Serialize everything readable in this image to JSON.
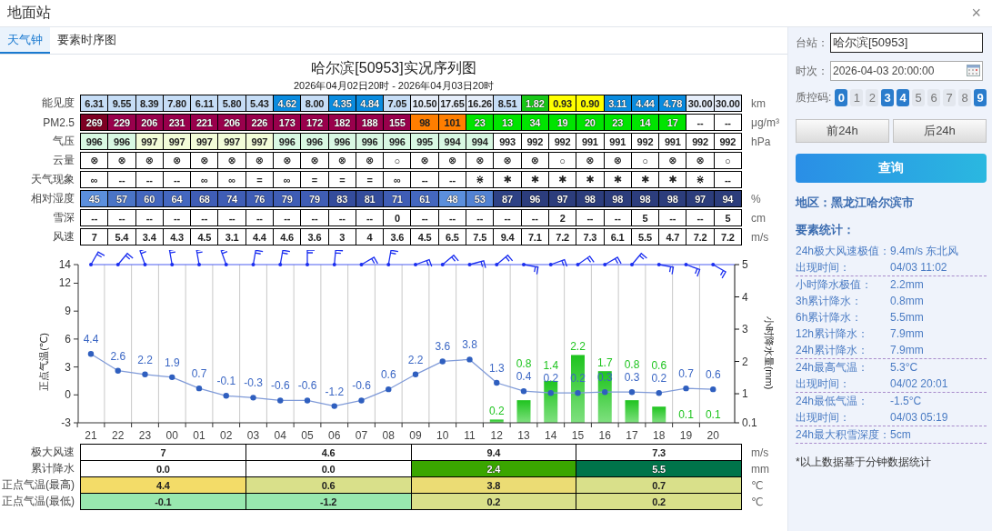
{
  "window": {
    "title": "地面站",
    "close": "×"
  },
  "tabs": [
    {
      "label": "天气钟",
      "selected": true
    },
    {
      "label": "要素时序图",
      "selected": false
    }
  ],
  "main": {
    "title": "哈尔滨[50953]实况序列图",
    "subtitle": "2026年04月02日20时 - 2026年04月03日20时",
    "table": {
      "rows": [
        {
          "label": "能见度",
          "unit": "km",
          "cells": [
            {
              "text": "6.31",
              "color": "#c6ddf6"
            },
            {
              "text": "9.55",
              "color": "#c6ddf6"
            },
            {
              "text": "8.39",
              "color": "#c6ddf6"
            },
            {
              "text": "7.80",
              "color": "#c6ddf6"
            },
            {
              "text": "6.11",
              "color": "#c6ddf6"
            },
            {
              "text": "5.80",
              "color": "#c6ddf6"
            },
            {
              "text": "5.43",
              "color": "#c6ddf6"
            },
            {
              "text": "4.62",
              "color": "#0a8ce0"
            },
            {
              "text": "8.00",
              "color": "#c6ddf6"
            },
            {
              "text": "4.35",
              "color": "#0a8ce0"
            },
            {
              "text": "4.84",
              "color": "#0a8ce0"
            },
            {
              "text": "7.05",
              "color": "#c6ddf6"
            },
            {
              "text": "10.50",
              "color": "#e6eefa"
            },
            {
              "text": "17.65",
              "color": "#e6eefa"
            },
            {
              "text": "16.26",
              "color": "#e6eefa"
            },
            {
              "text": "8.51",
              "color": "#c6ddf6"
            },
            {
              "text": "1.82",
              "color": "#18c818"
            },
            {
              "text": "0.93",
              "color": "#ffff00"
            },
            {
              "text": "0.90",
              "color": "#ffff00"
            },
            {
              "text": "3.11",
              "color": "#0a8ce0"
            },
            {
              "text": "4.44",
              "color": "#0a8ce0"
            },
            {
              "text": "4.78",
              "color": "#0a8ce0"
            },
            {
              "text": "30.00",
              "color": "#e6eefa"
            },
            {
              "text": "30.00",
              "color": "#e6eefa"
            }
          ]
        },
        {
          "label": "PM2.5",
          "unit": "μg/m³",
          "cells": [
            {
              "text": "269",
              "color": "#7e0023"
            },
            {
              "text": "229",
              "color": "#99004c"
            },
            {
              "text": "206",
              "color": "#99004c"
            },
            {
              "text": "231",
              "color": "#99004c"
            },
            {
              "text": "221",
              "color": "#99004c"
            },
            {
              "text": "206",
              "color": "#99004c"
            },
            {
              "text": "226",
              "color": "#99004c"
            },
            {
              "text": "173",
              "color": "#99004c"
            },
            {
              "text": "172",
              "color": "#99004c"
            },
            {
              "text": "182",
              "color": "#99004c"
            },
            {
              "text": "188",
              "color": "#99004c"
            },
            {
              "text": "155",
              "color": "#99004c"
            },
            {
              "text": "98",
              "color": "#ff7e00"
            },
            {
              "text": "101",
              "color": "#ff7e00"
            },
            {
              "text": "23",
              "color": "#00e400"
            },
            {
              "text": "13",
              "color": "#00e400"
            },
            {
              "text": "34",
              "color": "#00e400"
            },
            {
              "text": "19",
              "color": "#00e400"
            },
            {
              "text": "20",
              "color": "#00e400"
            },
            {
              "text": "23",
              "color": "#00e400"
            },
            {
              "text": "14",
              "color": "#00e400"
            },
            {
              "text": "17",
              "color": "#00e400"
            },
            {
              "text": "--",
              "color": "#ffffff"
            },
            {
              "text": "--",
              "color": "#ffffff"
            }
          ]
        },
        {
          "label": "气压",
          "unit": "hPa",
          "cells": [
            {
              "text": "996",
              "color": "#d8f8e2"
            },
            {
              "text": "996",
              "color": "#d8f8e2"
            },
            {
              "text": "997",
              "color": "#f2fcd8"
            },
            {
              "text": "997",
              "color": "#f2fcd8"
            },
            {
              "text": "997",
              "color": "#f2fcd8"
            },
            {
              "text": "997",
              "color": "#f2fcd8"
            },
            {
              "text": "997",
              "color": "#f2fcd8"
            },
            {
              "text": "996",
              "color": "#d8f8e2"
            },
            {
              "text": "996",
              "color": "#d8f8e2"
            },
            {
              "text": "996",
              "color": "#d8f8e2"
            },
            {
              "text": "996",
              "color": "#d8f8e2"
            },
            {
              "text": "996",
              "color": "#d8f8e2"
            },
            {
              "text": "995",
              "color": "#d8f8e2"
            },
            {
              "text": "994",
              "color": "#d8f8e2"
            },
            {
              "text": "994",
              "color": "#d8f8e2"
            },
            {
              "text": "993",
              "color": "#ffffff"
            },
            {
              "text": "992",
              "color": "#ffffff"
            },
            {
              "text": "992",
              "color": "#ffffff"
            },
            {
              "text": "991",
              "color": "#ffffff"
            },
            {
              "text": "991",
              "color": "#ffffff"
            },
            {
              "text": "992",
              "color": "#ffffff"
            },
            {
              "text": "991",
              "color": "#ffffff"
            },
            {
              "text": "992",
              "color": "#ffffff"
            },
            {
              "text": "992",
              "color": "#ffffff"
            }
          ]
        },
        {
          "label": "云量",
          "cells": [
            {
              "text": "⊗"
            },
            {
              "text": "⊗"
            },
            {
              "text": "⊗"
            },
            {
              "text": "⊗"
            },
            {
              "text": "⊗"
            },
            {
              "text": "⊗"
            },
            {
              "text": "⊗"
            },
            {
              "text": "⊗"
            },
            {
              "text": "⊗"
            },
            {
              "text": "⊗"
            },
            {
              "text": "⊗"
            },
            {
              "text": "○"
            },
            {
              "text": "⊗"
            },
            {
              "text": "⊗"
            },
            {
              "text": "⊗"
            },
            {
              "text": "⊗"
            },
            {
              "text": "⊗"
            },
            {
              "text": "○"
            },
            {
              "text": "⊗"
            },
            {
              "text": "⊗"
            },
            {
              "text": "○"
            },
            {
              "text": "⊗"
            },
            {
              "text": "⊗"
            },
            {
              "text": "○"
            }
          ]
        },
        {
          "label": "天气现象",
          "cells": [
            {
              "text": "∞"
            },
            {
              "text": "--"
            },
            {
              "text": "--"
            },
            {
              "text": "--"
            },
            {
              "text": "∞"
            },
            {
              "text": "∞"
            },
            {
              "text": "="
            },
            {
              "text": "∞"
            },
            {
              "text": "="
            },
            {
              "text": "="
            },
            {
              "text": "="
            },
            {
              "text": "∞"
            },
            {
              "text": "--"
            },
            {
              "text": "--"
            },
            {
              "text": "⋇"
            },
            {
              "text": "✱"
            },
            {
              "text": "✱"
            },
            {
              "text": "✱"
            },
            {
              "text": "✱"
            },
            {
              "text": "✱"
            },
            {
              "text": "✱"
            },
            {
              "text": "✱"
            },
            {
              "text": "⋇"
            },
            {
              "text": "--"
            }
          ]
        },
        {
          "label": "相对湿度",
          "unit": "%",
          "cells": [
            {
              "text": "45",
              "color": "#5b8fdc"
            },
            {
              "text": "57",
              "color": "#4a74c6"
            },
            {
              "text": "60",
              "color": "#4467bf"
            },
            {
              "text": "64",
              "color": "#4467bf"
            },
            {
              "text": "68",
              "color": "#3f5db5"
            },
            {
              "text": "74",
              "color": "#3f5db5"
            },
            {
              "text": "76",
              "color": "#3f5db5"
            },
            {
              "text": "79",
              "color": "#3f5db5"
            },
            {
              "text": "79",
              "color": "#3f5db5"
            },
            {
              "text": "83",
              "color": "#344c9c"
            },
            {
              "text": "81",
              "color": "#344c9c"
            },
            {
              "text": "71",
              "color": "#3f5db5"
            },
            {
              "text": "61",
              "color": "#4467bf"
            },
            {
              "text": "48",
              "color": "#5b8fdc"
            },
            {
              "text": "53",
              "color": "#5282d2"
            },
            {
              "text": "87",
              "color": "#2e4285"
            },
            {
              "text": "96",
              "color": "#2c3d7c"
            },
            {
              "text": "97",
              "color": "#2c3d7c"
            },
            {
              "text": "98",
              "color": "#2c3d7c"
            },
            {
              "text": "98",
              "color": "#2c3d7c"
            },
            {
              "text": "98",
              "color": "#2c3d7c"
            },
            {
              "text": "98",
              "color": "#2c3d7c"
            },
            {
              "text": "97",
              "color": "#2c3d7c"
            },
            {
              "text": "94",
              "color": "#2c3d7c"
            }
          ]
        },
        {
          "label": "雪深",
          "unit": "cm",
          "cells": [
            {
              "text": "--"
            },
            {
              "text": "--"
            },
            {
              "text": "--"
            },
            {
              "text": "--"
            },
            {
              "text": "--"
            },
            {
              "text": "--"
            },
            {
              "text": "--"
            },
            {
              "text": "--"
            },
            {
              "text": "--"
            },
            {
              "text": "--"
            },
            {
              "text": "--"
            },
            {
              "text": "0"
            },
            {
              "text": "--"
            },
            {
              "text": "--"
            },
            {
              "text": "--"
            },
            {
              "text": "--"
            },
            {
              "text": "--"
            },
            {
              "text": "2"
            },
            {
              "text": "--"
            },
            {
              "text": "--"
            },
            {
              "text": "5"
            },
            {
              "text": "--"
            },
            {
              "text": "--"
            },
            {
              "text": "5"
            }
          ]
        },
        {
          "label": "风速",
          "unit": "m/s",
          "cells": [
            {
              "text": "7"
            },
            {
              "text": "5.4"
            },
            {
              "text": "3.4"
            },
            {
              "text": "4.3"
            },
            {
              "text": "4.5"
            },
            {
              "text": "3.1"
            },
            {
              "text": "4.4"
            },
            {
              "text": "4.6"
            },
            {
              "text": "3.6"
            },
            {
              "text": "3"
            },
            {
              "text": "4"
            },
            {
              "text": "3.6"
            },
            {
              "text": "4.5"
            },
            {
              "text": "6.5"
            },
            {
              "text": "7.5"
            },
            {
              "text": "9.4"
            },
            {
              "text": "7.1"
            },
            {
              "text": "7.2"
            },
            {
              "text": "7.3"
            },
            {
              "text": "6.1"
            },
            {
              "text": "5.5"
            },
            {
              "text": "4.7"
            },
            {
              "text": "7.2"
            },
            {
              "text": "7.2"
            }
          ]
        }
      ]
    },
    "chart": {
      "temperature": {
        "chart_data": {
          "type": "line",
          "ylabel": "正点气温(℃)",
          "categories": [
            "21",
            "22",
            "23",
            "00",
            "01",
            "02",
            "03",
            "04",
            "05",
            "06",
            "07",
            "08",
            "09",
            "10",
            "11",
            "12",
            "13",
            "14",
            "15",
            "16",
            "17",
            "18",
            "19",
            "20"
          ],
          "ylim": [
            -3,
            14
          ],
          "yticks": [
            -3,
            0,
            3,
            6,
            9,
            12,
            14
          ],
          "data_labels": true,
          "series": [
            {
              "color": "#2f5fbf",
              "marker": true,
              "values": [
                4.4,
                2.6,
                2.2,
                1.9,
                0.7,
                -0.1,
                -0.3,
                -0.6,
                -0.6,
                -1.2,
                -0.6,
                0.6,
                2.2,
                3.6,
                3.8,
                1.3,
                0.4,
                0.2,
                0.2,
                0.3,
                0.3,
                0.2,
                0.7,
                0.6
              ]
            }
          ]
        }
      },
      "precipitation": {
        "chart_data": {
          "type": "bar",
          "ylabel": "小时降水量(mm)",
          "ylim": [
            0.1,
            5
          ],
          "yticks": [
            {
              "value": 0.1,
              "label": "0.1"
            },
            1,
            2,
            3,
            4,
            5
          ],
          "data_labels": true,
          "series": [
            {
              "color": "#1fc41f",
              "values": [
                null,
                null,
                null,
                null,
                null,
                null,
                null,
                null,
                null,
                null,
                null,
                null,
                null,
                null,
                null,
                0.2,
                0.8,
                1.4,
                2.2,
                1.7,
                0.8,
                0.6,
                0.1,
                0.1
              ]
            }
          ]
        }
      }
    },
    "summary": {
      "rows": [
        {
          "label": "极大风速",
          "unit": "m/s",
          "cells": [
            {
              "text": "7"
            },
            {
              "text": "4.6"
            },
            {
              "text": "9.4"
            },
            {
              "text": "7.3"
            }
          ]
        },
        {
          "label": "累计降水",
          "unit": "mm",
          "cells": [
            {
              "text": "0.0",
              "color": "#ffffff"
            },
            {
              "text": "0.0",
              "color": "#ffffff"
            },
            {
              "text": "2.4",
              "color": "#3aa600"
            },
            {
              "text": "5.5",
              "color": "#00744a"
            }
          ]
        },
        {
          "label": "正点气温(最高)",
          "unit": "℃",
          "cells": [
            {
              "text": "4.4",
              "color": "#f3dc68"
            },
            {
              "text": "0.6",
              "color": "#d9e08a"
            },
            {
              "text": "3.8",
              "color": "#ebdc74"
            },
            {
              "text": "0.7",
              "color": "#d9e08a"
            }
          ]
        },
        {
          "label": "正点气温(最低)",
          "unit": "℃",
          "cells": [
            {
              "text": "-0.1",
              "color": "#98e8ae"
            },
            {
              "text": "-1.2",
              "color": "#98e8ae"
            },
            {
              "text": "0.2",
              "color": "#d9e08a"
            },
            {
              "text": "0.2",
              "color": "#d9e08a"
            }
          ]
        }
      ]
    }
  },
  "panel": {
    "station": {
      "label": "台站：",
      "value": "哈尔滨[50953]"
    },
    "time": {
      "label": "时次：",
      "value": "2026-04-03 20:00:00"
    },
    "qc": {
      "label": "质控码:",
      "codes": [
        {
          "label": "0",
          "selected": true
        },
        {
          "label": "1",
          "selected": false
        },
        {
          "label": "2",
          "selected": false
        },
        {
          "label": "3",
          "selected": true
        },
        {
          "label": "4",
          "selected": true
        },
        {
          "label": "5",
          "selected": false
        },
        {
          "label": "6",
          "selected": false
        },
        {
          "label": "7",
          "selected": false
        },
        {
          "label": "8",
          "selected": false
        },
        {
          "label": "9",
          "selected": true
        }
      ]
    },
    "nav_buttons": [
      "前24h",
      "后24h"
    ],
    "query_button": "查询",
    "region": "地区：黑龙江哈尔滨市",
    "stats_title": "要素统计：",
    "stat_groups": [
      [
        {
          "label": "24h极大风速极值：",
          "value": "9.4m/s 东北风"
        },
        {
          "label": "出现时间：",
          "value": "04/03 11:02"
        }
      ],
      [
        {
          "label": "小时降水极值：",
          "value": "2.2mm"
        },
        {
          "label": "3h累计降水：",
          "value": "0.8mm"
        },
        {
          "label": "6h累计降水：",
          "value": "5.5mm"
        },
        {
          "label": "12h累计降水：",
          "value": "7.9mm"
        },
        {
          "label": "24h累计降水：",
          "value": "7.9mm"
        }
      ],
      [
        {
          "label": "24h最高气温：",
          "value": "5.3°C"
        },
        {
          "label": "出现时间：",
          "value": "04/02 20:01"
        }
      ],
      [
        {
          "label": "24h最低气温：",
          "value": "-1.5°C"
        },
        {
          "label": "出现时间：",
          "value": "04/03 05:19"
        }
      ],
      [
        {
          "label": "24h最大积雪深度：",
          "value": "5cm"
        }
      ]
    ],
    "footnote": "*以上数据基于分钟数据统计"
  }
}
